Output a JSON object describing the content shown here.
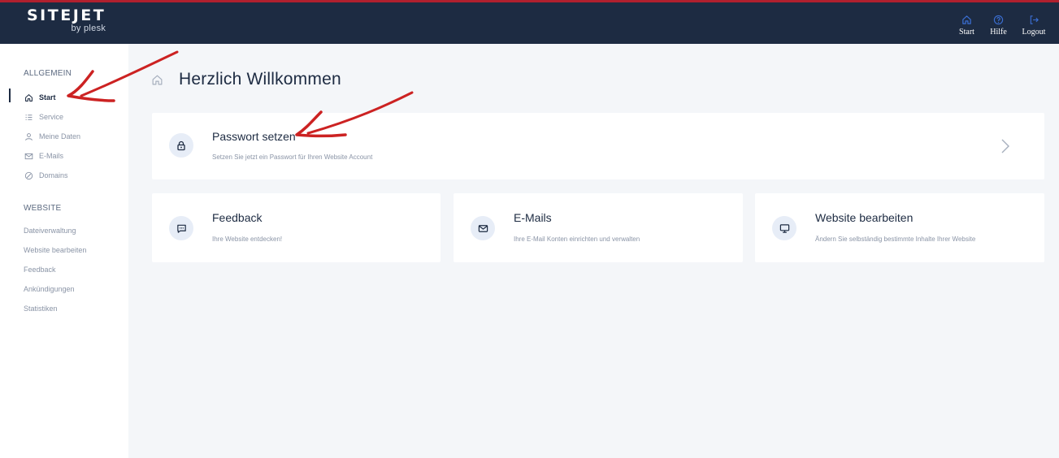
{
  "brand": {
    "name": "SITEJET",
    "sub": "by plesk"
  },
  "topnav": [
    {
      "label": "Start",
      "icon": "home-icon"
    },
    {
      "label": "Hilfe",
      "icon": "help-icon"
    },
    {
      "label": "Logout",
      "icon": "logout-icon"
    }
  ],
  "sidebar": {
    "section_general": "ALLGEMEIN",
    "items": [
      {
        "label": "Start",
        "icon": "home-icon",
        "active": true
      },
      {
        "label": "Service",
        "icon": "list-icon"
      },
      {
        "label": "Meine Daten",
        "icon": "user-icon"
      },
      {
        "label": "E-Mails",
        "icon": "mail-icon"
      },
      {
        "label": "Domains",
        "icon": "domain-icon"
      }
    ],
    "section_website": "WEBSITE",
    "links": [
      {
        "label": "Dateiverwaltung"
      },
      {
        "label": "Website bearbeiten"
      },
      {
        "label": "Feedback"
      },
      {
        "label": "Ankündigungen"
      },
      {
        "label": "Statistiken"
      }
    ]
  },
  "main": {
    "title": "Herzlich Willkommen",
    "password_card": {
      "title": "Passwort setzen",
      "desc": "Setzen Sie jetzt ein Passwort für Ihren Website Account"
    },
    "cards": [
      {
        "title": "Feedback",
        "desc": "Ihre Website entdecken!",
        "icon": "chat-icon"
      },
      {
        "title": "E-Mails",
        "desc": "Ihre E-Mail Konten einrichten und verwalten",
        "icon": "mail-icon"
      },
      {
        "title": "Website bearbeiten",
        "desc": "Ändern Sie selbständig bestimmte Inhalte Ihrer Website",
        "icon": "monitor-icon"
      }
    ]
  },
  "colors": {
    "header": "#1d2b42",
    "accent": "#3b6fd4",
    "annotation": "#cc2222"
  }
}
